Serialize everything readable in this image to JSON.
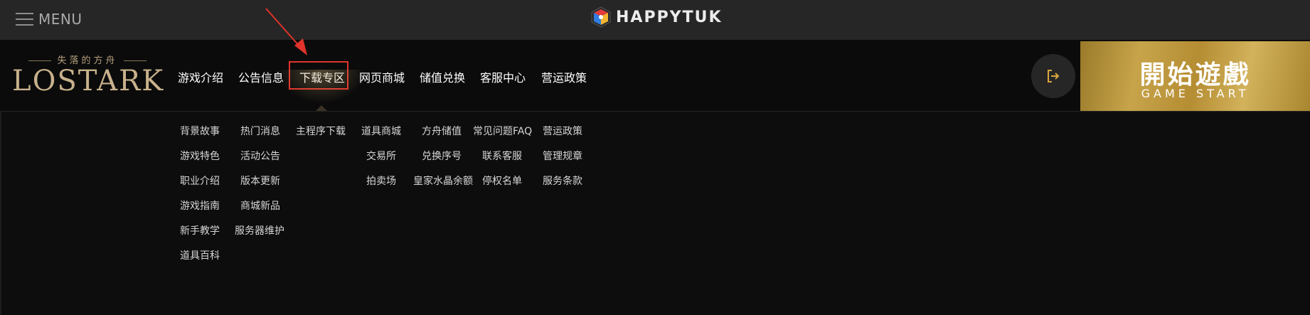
{
  "topbar": {
    "menu_label": "MENU",
    "logo_text": "HAPPYTUK"
  },
  "brand": {
    "subtitle": "失落的方舟",
    "title": "LOSTARK"
  },
  "nav": {
    "items": [
      "游戏介绍",
      "公告信息",
      "下载专区",
      "网页商城",
      "储值兑换",
      "客服中心",
      "营运政策"
    ],
    "highlighted": "下载专区"
  },
  "submenu": {
    "col1": [
      "背景故事",
      "游戏特色",
      "职业介绍",
      "游戏指南",
      "新手教学",
      "道具百科"
    ],
    "col2": [
      "热门消息",
      "活动公告",
      "版本更新",
      "商城新品",
      "服务器维护"
    ],
    "col3": [
      "主程序下载"
    ],
    "col4": [
      "道具商城",
      "交易所",
      "拍卖场"
    ],
    "col5": [
      "方舟储值",
      "兑换序号",
      "皇家水晶余额"
    ],
    "col6": [
      "常见问题FAQ",
      "联系客服",
      "停权名单"
    ],
    "col7": [
      "营运政策",
      "管理规章",
      "服务条款"
    ]
  },
  "start_button": {
    "label_zh": "開始遊戲",
    "label_en": "GAME START"
  },
  "colors": {
    "highlight_border": "#e0332b",
    "start_gold": "#c7a44a",
    "annotation_arrow": "#e0332b"
  },
  "icons": {
    "menu": "hamburger-icon",
    "logout": "logout-icon",
    "logo": "happytuk-cube-logo-icon",
    "annotation": "red-arrow-icon"
  }
}
